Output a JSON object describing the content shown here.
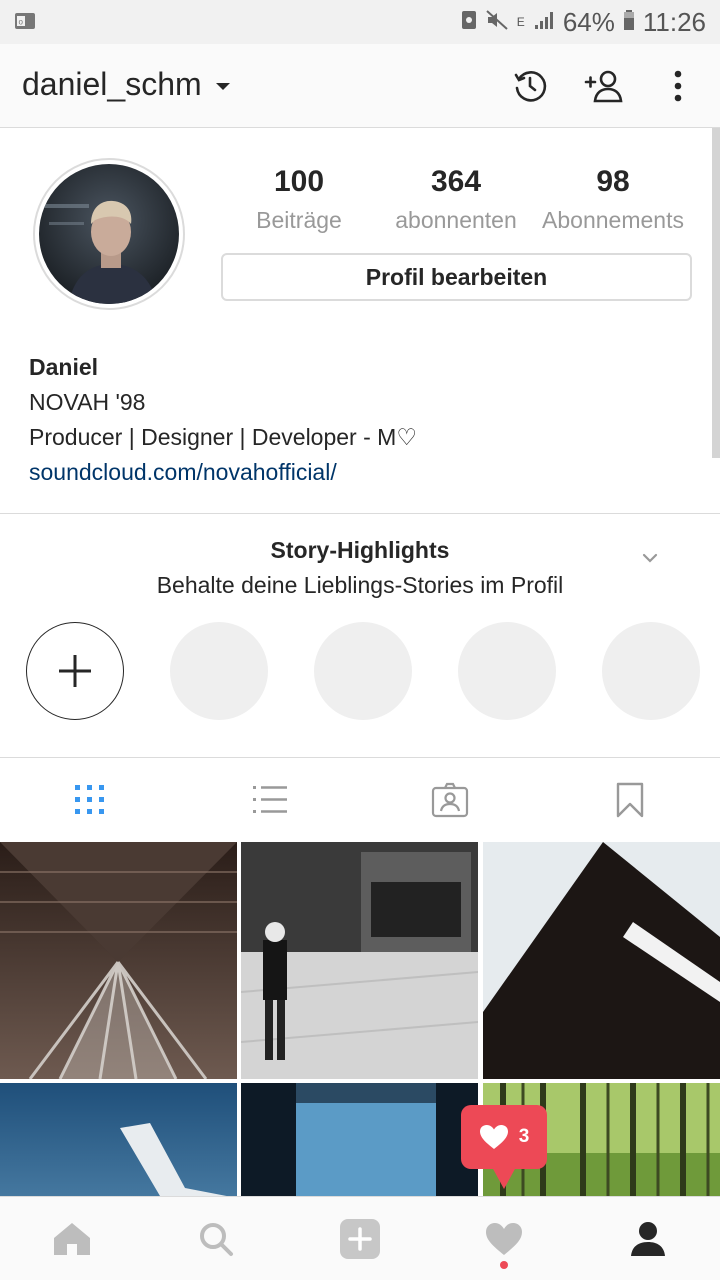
{
  "status_bar": {
    "battery": "64%",
    "time": "11:26",
    "network": "E"
  },
  "header": {
    "username": "daniel_schm"
  },
  "profile": {
    "stats": [
      {
        "value": "100",
        "label": "Beiträge"
      },
      {
        "value": "364",
        "label": "abonnenten"
      },
      {
        "value": "98",
        "label": "Abonnements"
      }
    ],
    "edit_button": "Profil bearbeiten",
    "bio": {
      "name": "Daniel",
      "line1": "NOVAH '98",
      "line2": "Producer | Designer | Developer - M♡",
      "link": "soundcloud.com/novahofficial/"
    }
  },
  "highlights": {
    "title": "Story-Highlights",
    "subtitle": "Behalte deine Lieblings-Stories im Profil"
  },
  "tabs": [
    {
      "icon": "grid-icon",
      "active": true
    },
    {
      "icon": "list-icon",
      "active": false
    },
    {
      "icon": "tagged-icon",
      "active": false
    },
    {
      "icon": "bookmark-icon",
      "active": false
    }
  ],
  "notification": {
    "count": "3"
  },
  "bottom_nav": [
    "home-icon",
    "search-icon",
    "add-icon",
    "activity-heart-icon",
    "profile-icon"
  ],
  "colors": {
    "accent_blue": "#3897f0",
    "link": "#003569",
    "notification_red": "#ed4956",
    "muted": "#999999"
  }
}
